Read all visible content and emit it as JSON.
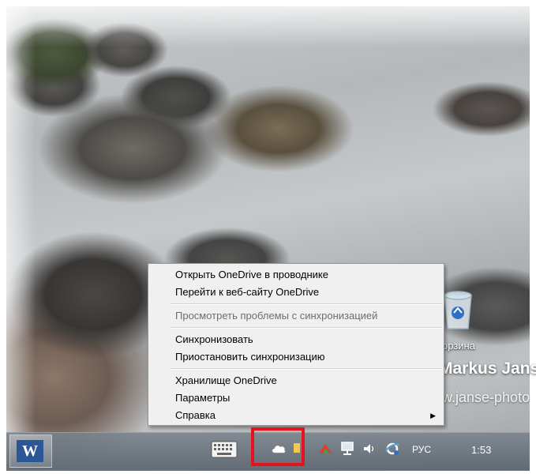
{
  "desktop": {
    "recycle_bin_label": "орзина",
    "watermark_name": "Markus Jans",
    "watermark_url": "w.janse-photo"
  },
  "context_menu": {
    "items": [
      {
        "label": "Открыть OneDrive в проводнике",
        "enabled": true
      },
      {
        "label": "Перейти к веб-сайту OneDrive",
        "enabled": true
      },
      {
        "label": "Просмотреть проблемы с синхронизацией",
        "enabled": false
      },
      {
        "label": "Синхронизовать",
        "enabled": true
      },
      {
        "label": "Приостановить синхронизацию",
        "enabled": true
      },
      {
        "label": "Хранилище OneDrive",
        "enabled": true
      },
      {
        "label": "Параметры",
        "enabled": true
      },
      {
        "label": "Справка",
        "enabled": true,
        "submenu": true
      }
    ]
  },
  "taskbar": {
    "word_icon_letter": "W",
    "language": "РУС",
    "clock": "1:53",
    "highlight_color": "#e8121b"
  }
}
